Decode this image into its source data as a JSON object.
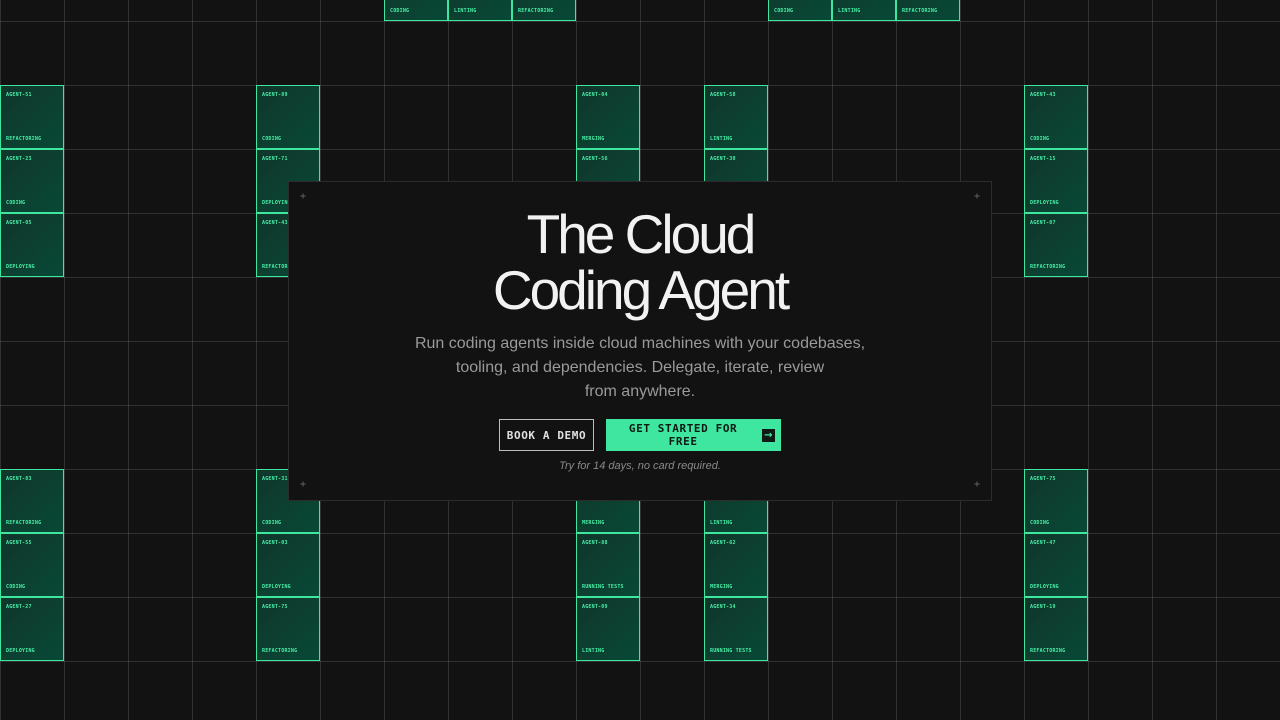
{
  "hero": {
    "title_line_1": "The Cloud",
    "title_line_2": "Coding Agent",
    "subtitle_line_1": "Run coding agents inside cloud machines with your codebases,",
    "subtitle_line_2": "tooling, and dependencies. Delegate, iterate, review",
    "subtitle_line_3": "from anywhere.",
    "secondary_cta": "BOOK A DEMO",
    "primary_cta": "GET STARTED FOR FREE",
    "primary_cta_icon": "arrow-right-icon",
    "trial_note": "Try for 14 days, no card required.",
    "corner_glyph": "+"
  },
  "colors": {
    "background": "#121212",
    "accent": "#3ee6a0",
    "tile_text": "#48f0a8",
    "heading": "#f2f2f2",
    "subtext": "#9a9a9a"
  },
  "agent_tiles": [
    {
      "id": "",
      "status": "CODING"
    },
    {
      "id": "",
      "status": "LINTING"
    },
    {
      "id": "",
      "status": "REFACTORING"
    },
    {
      "id": "",
      "status": "CODING"
    },
    {
      "id": "",
      "status": "LINTING"
    },
    {
      "id": "",
      "status": "REFACTORING"
    },
    {
      "id": "AGENT-51",
      "status": "REFACTORING"
    },
    {
      "id": "AGENT-89",
      "status": "CODING"
    },
    {
      "id": "AGENT-04",
      "status": "MERGING"
    },
    {
      "id": "AGENT-58",
      "status": "LINTING"
    },
    {
      "id": "AGENT-43",
      "status": "CODING"
    },
    {
      "id": "AGENT-23",
      "status": "CODING"
    },
    {
      "id": "AGENT-71",
      "status": "DEPLOYING"
    },
    {
      "id": "AGENT-56",
      "status": ""
    },
    {
      "id": "AGENT-30",
      "status": ""
    },
    {
      "id": "AGENT-15",
      "status": "DEPLOYING"
    },
    {
      "id": "AGENT-05",
      "status": "DEPLOYING"
    },
    {
      "id": "AGENT-43",
      "status": "REFACTORING"
    },
    {
      "id": "AGENT-07",
      "status": "REFACTORING"
    },
    {
      "id": "AGENT-83",
      "status": "REFACTORING"
    },
    {
      "id": "AGENT-31",
      "status": "CODING"
    },
    {
      "id": "",
      "status": "MERGING"
    },
    {
      "id": "",
      "status": "LINTING"
    },
    {
      "id": "AGENT-75",
      "status": "CODING"
    },
    {
      "id": "AGENT-55",
      "status": "CODING"
    },
    {
      "id": "AGENT-03",
      "status": "DEPLOYING"
    },
    {
      "id": "AGENT-88",
      "status": "RUNNING TESTS"
    },
    {
      "id": "AGENT-62",
      "status": "MERGING"
    },
    {
      "id": "AGENT-47",
      "status": "DEPLOYING"
    },
    {
      "id": "AGENT-27",
      "status": "DEPLOYING"
    },
    {
      "id": "AGENT-75",
      "status": "REFACTORING"
    },
    {
      "id": "AGENT-09",
      "status": "LINTING"
    },
    {
      "id": "AGENT-34",
      "status": "RUNNING TESTS"
    },
    {
      "id": "AGENT-19",
      "status": "REFACTORING"
    }
  ]
}
